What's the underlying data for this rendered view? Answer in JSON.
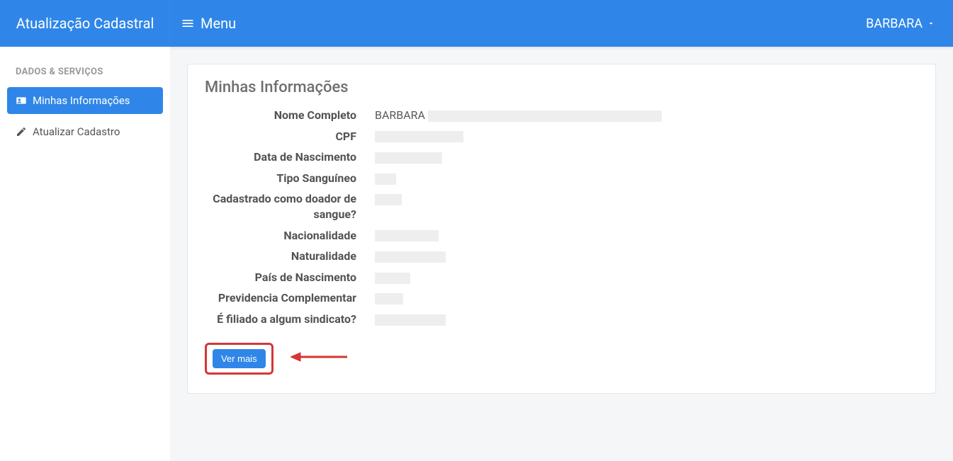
{
  "header": {
    "brand": "Atualização Cadastral",
    "menu_label": "Menu",
    "user_name": "BARBARA"
  },
  "sidebar": {
    "heading": "DADOS & SERVIÇOS",
    "items": [
      {
        "label": "Minhas Informações",
        "active": true
      },
      {
        "label": "Atualizar Cadastro",
        "active": false
      }
    ]
  },
  "card": {
    "title": "Minhas Informações",
    "fields": [
      {
        "label": "Nome Completo",
        "value": "BARBARA",
        "tail_redact_w": 330
      },
      {
        "label": "CPF",
        "value": "",
        "redact_w": 125
      },
      {
        "label": "Data de Nascimento",
        "value": "",
        "redact_w": 95
      },
      {
        "label": "Tipo Sanguíneo",
        "value": "",
        "redact_w": 30
      },
      {
        "label": "Cadastrado como doador de sangue?",
        "value": "",
        "redact_w": 38
      },
      {
        "label": "Nacionalidade",
        "value": "",
        "redact_w": 90
      },
      {
        "label": "Naturalidade",
        "value": "",
        "redact_w": 100
      },
      {
        "label": "País de Nascimento",
        "value": "",
        "redact_w": 50
      },
      {
        "label": "Previdencia Complementar",
        "value": "",
        "redact_w": 40
      },
      {
        "label": "É filiado a algum sindicato?",
        "value": "",
        "redact_w": 100
      }
    ],
    "button_label": "Ver mais"
  }
}
